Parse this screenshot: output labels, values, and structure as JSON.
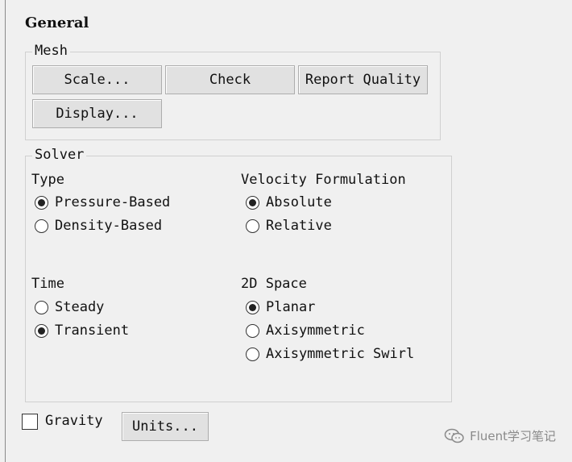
{
  "panel": {
    "title": "General"
  },
  "mesh": {
    "legend": "Mesh",
    "scale_label": "Scale...",
    "check_label": "Check",
    "report_quality_label": "Report Quality",
    "display_label": "Display..."
  },
  "solver": {
    "legend": "Solver",
    "type": {
      "label": "Type",
      "options": [
        {
          "label": "Pressure-Based",
          "checked": true
        },
        {
          "label": "Density-Based",
          "checked": false
        }
      ]
    },
    "velocity_formulation": {
      "label": "Velocity Formulation",
      "options": [
        {
          "label": "Absolute",
          "checked": true
        },
        {
          "label": "Relative",
          "checked": false
        }
      ]
    },
    "time": {
      "label": "Time",
      "options": [
        {
          "label": "Steady",
          "checked": false
        },
        {
          "label": "Transient",
          "checked": true
        }
      ]
    },
    "space_2d": {
      "label": "2D Space",
      "options": [
        {
          "label": "Planar",
          "checked": true
        },
        {
          "label": "Axisymmetric",
          "checked": false
        },
        {
          "label": "Axisymmetric Swirl",
          "checked": false
        }
      ]
    }
  },
  "footer": {
    "gravity_label": "Gravity",
    "gravity_checked": false,
    "units_label": "Units..."
  },
  "watermark": {
    "text": "Fluent学习笔记",
    "icon": "wechat-icon"
  }
}
